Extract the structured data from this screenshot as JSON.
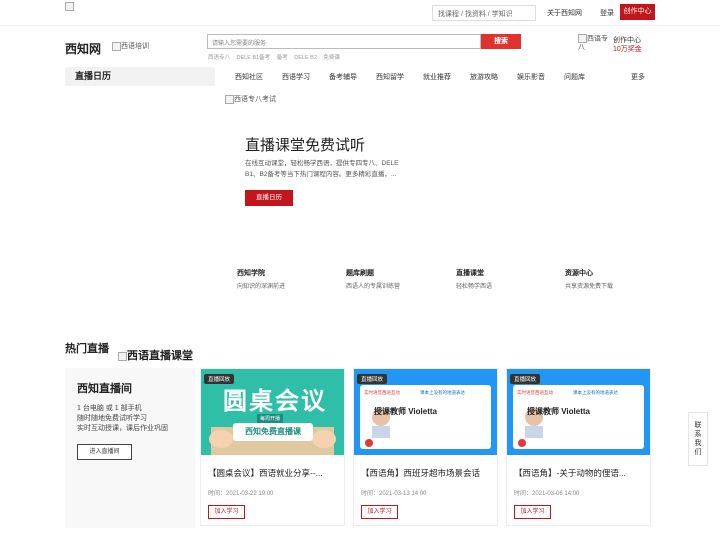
{
  "topbar": {
    "search_placeholder": "找课程 / 找资料 / 学知识",
    "about": "关于西知网",
    "login": "登录",
    "create": "创作中心"
  },
  "header": {
    "logo": "西知网",
    "logo_alt": "西语培训",
    "search_placeholder": "请输入您需要的服务",
    "search_button": "搜索",
    "hot_keys": [
      "西语专八",
      "DELE B1备考",
      "备考",
      "DELE B2",
      "免费课"
    ],
    "creator_img_alt": "西语专八",
    "creator_title": "创作中心",
    "creator_sub": "10万奖金"
  },
  "nav": {
    "calendar": "直播日历",
    "items": [
      "西知社区",
      "西语学习",
      "备考辅导",
      "西知留学",
      "就业推荐",
      "旅游攻略",
      "娱乐影音",
      "问题库",
      "更多"
    ]
  },
  "banner": {
    "img_alt": "西语专八考试",
    "title": "直播课堂免费试听",
    "desc": "在线互动课堂，轻松畅学西语，提供专四专八、DELE B1、B2备考等当下热门课程内容。更多精彩直播，...",
    "button": "直播日历"
  },
  "features": [
    {
      "title": "西知学院",
      "sub": "向知识的深渊前进"
    },
    {
      "title": "题库刷题",
      "sub": "西语人的专属训练营"
    },
    {
      "title": "直播课堂",
      "sub": "轻松畅学西语"
    },
    {
      "title": "资源中心",
      "sub": "共享资源免费下载"
    }
  ],
  "hot_live": {
    "title": "热门直播",
    "title_img_alt": "西语直播课堂",
    "intro": {
      "title": "西知直播间",
      "lines": [
        "1 台电脑 或 1 部手机",
        "随时随地免费试听学习",
        "实时互动授课，课后作业巩固"
      ],
      "button": "进入直播间"
    },
    "cards": [
      {
        "badge": "直播回放",
        "thumb_title": "圆桌会议",
        "thumb_sub": "西知免费直播课",
        "thumb_tag": "每周开播",
        "title": "【圆桌会议】西语就业分享--...",
        "time": "时间：2021-03-22 19:00",
        "button": "加入学习"
      },
      {
        "badge": "直播回放",
        "thumb_title": "授课教师 Violetta",
        "thumb_sub": "课本上没有的地道表达",
        "thumb_tag": "实时语音西语互动",
        "title": "【西语角】西班牙超市场景会话",
        "time": "时间：2021-03-13 14:00",
        "button": "加入学习"
      },
      {
        "badge": "直播回放",
        "thumb_title": "授课教师 Violetta",
        "thumb_sub": "课本上没有的地道表达",
        "thumb_tag": "实时语音西语互动",
        "title": "【西语角】-关于动物的俚语...",
        "time": "时间：2021-03-06 14:00",
        "button": "加入学习"
      }
    ]
  },
  "side_contact": "联系我们"
}
